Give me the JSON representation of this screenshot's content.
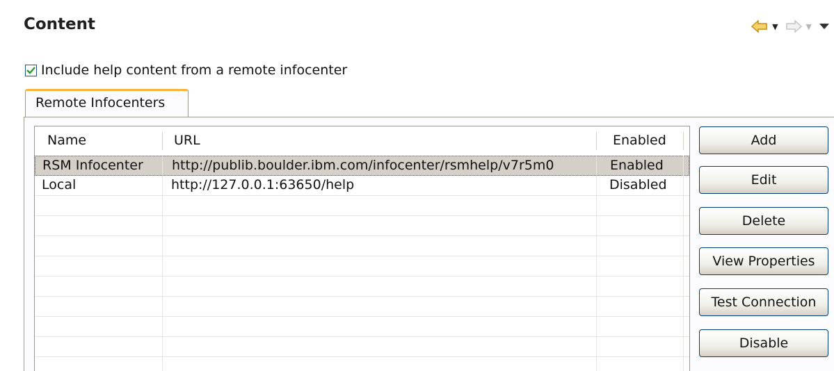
{
  "header": {
    "title": "Content",
    "nav": [
      {
        "icon": "back-arrow-icon",
        "dropdown": "▼"
      },
      {
        "icon": "forward-arrow-icon",
        "dropdown": "▼"
      },
      {
        "icon": "view-menu-icon"
      }
    ]
  },
  "include_remote": {
    "checked": true,
    "label": "Include help content from a remote infocenter"
  },
  "tabs": [
    {
      "label": "Remote Infocenters",
      "active": true
    }
  ],
  "table": {
    "columns": [
      "Name",
      "URL",
      "Enabled"
    ],
    "rows": [
      {
        "name": "RSM Infocenter",
        "url": "http://publib.boulder.ibm.com/infocenter/rsmhelp/v7r5m0",
        "enabled": "Enabled",
        "selected": true
      },
      {
        "name": "Local",
        "url": "http://127.0.0.1:63650/help",
        "enabled": "Disabled",
        "selected": false
      }
    ]
  },
  "buttons": {
    "add": "Add",
    "edit": "Edit",
    "delete": "Delete",
    "view_properties": "View Properties",
    "test_connection": "Test Connection",
    "disable": "Disable"
  },
  "colors": {
    "tab_accent": "#f9b13a",
    "back_arrow": "#f0b43c",
    "checkbox_check": "#21a121"
  }
}
